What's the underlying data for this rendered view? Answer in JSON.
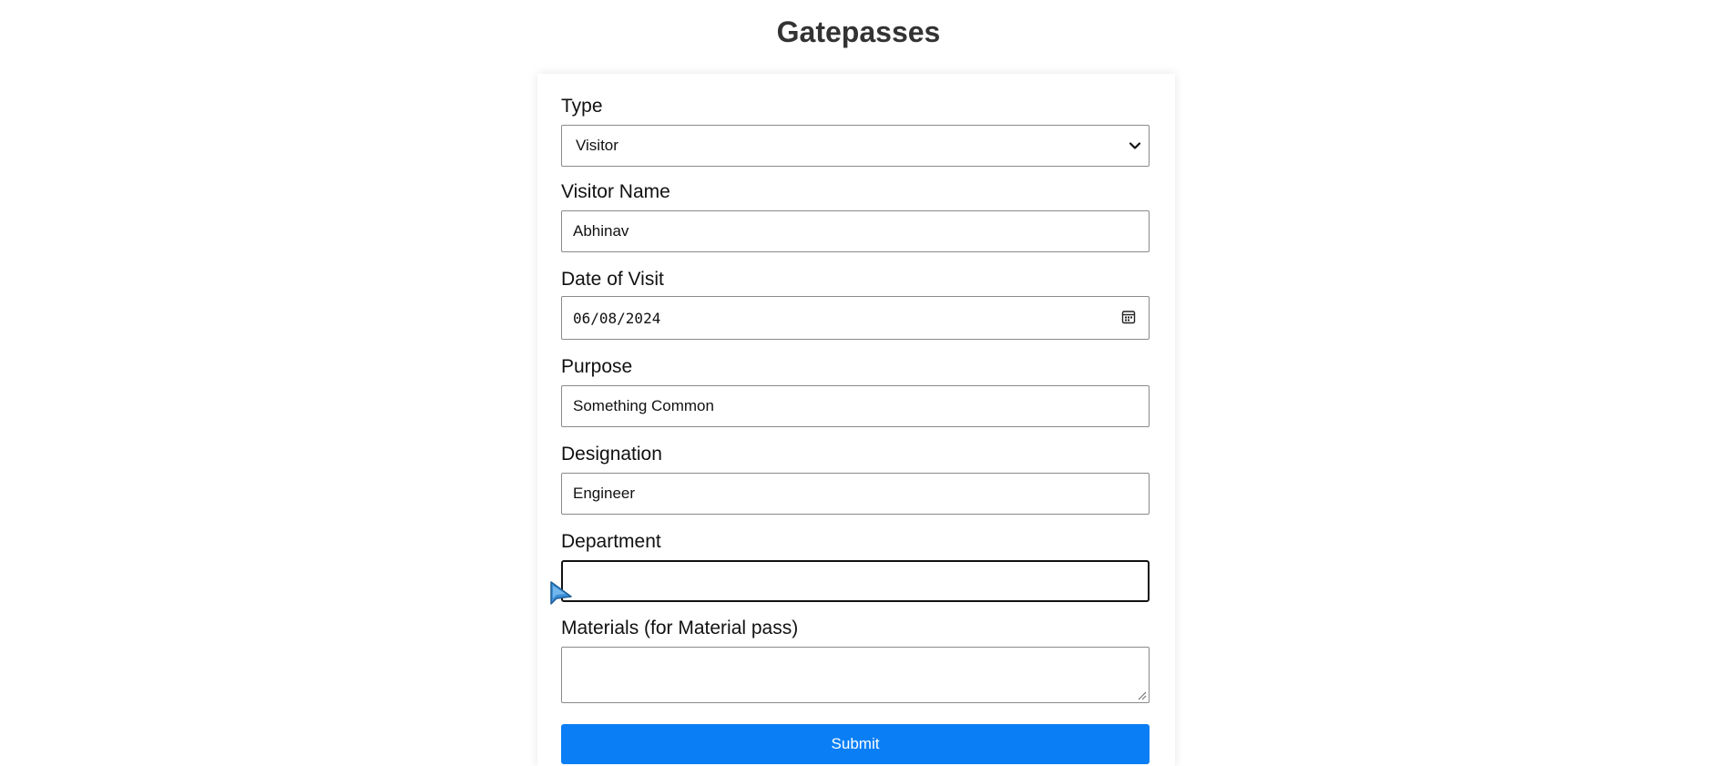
{
  "page": {
    "title": "Gatepasses"
  },
  "form": {
    "type": {
      "label": "Type",
      "selected": "Visitor",
      "icon": "chevron-down-icon"
    },
    "visitor_name": {
      "label": "Visitor Name",
      "value": "Abhinav"
    },
    "date_of_visit": {
      "label": "Date of Visit",
      "value": "06/08/2024",
      "icon": "calendar-icon"
    },
    "purpose": {
      "label": "Purpose",
      "value": "Something Common"
    },
    "designation": {
      "label": "Designation",
      "value": "Engineer"
    },
    "department": {
      "label": "Department",
      "value": "",
      "focused": true
    },
    "materials": {
      "label": "Materials (for Material pass)",
      "value": ""
    },
    "submit_label": "Submit"
  },
  "colors": {
    "accent": "#0a7ff5",
    "title": "#333333",
    "border": "#8a8a8a"
  }
}
